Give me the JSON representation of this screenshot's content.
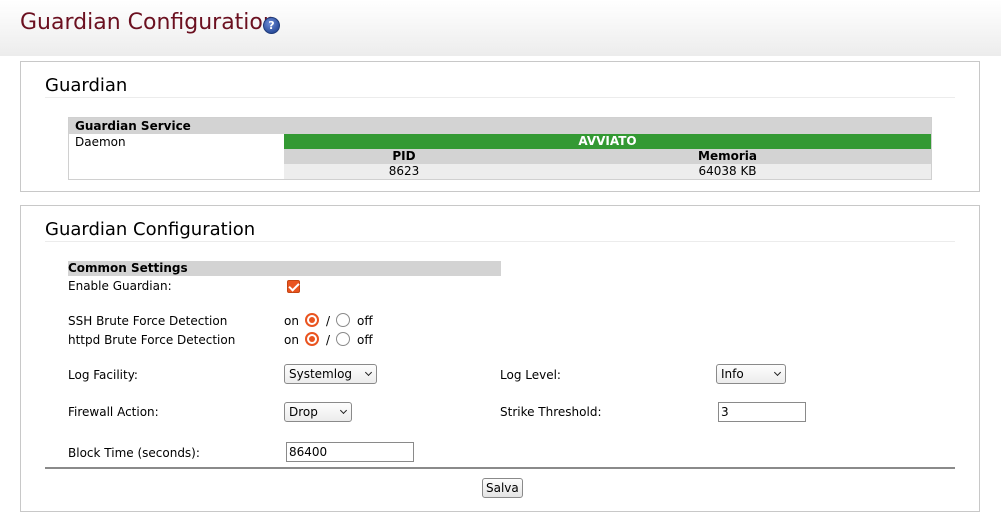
{
  "header": {
    "title": "Guardian Configuration",
    "help_icon": "help-icon"
  },
  "service_box": {
    "title": "Guardian",
    "table_header": "Guardian Service",
    "daemon_label": "Daemon",
    "status": "AVVIATO",
    "status_color": "#339933",
    "pid_header": "PID",
    "memory_header": "Memoria",
    "pid_value": "8623",
    "memory_value": "64038 KB"
  },
  "config_box": {
    "title": "Guardian Configuration",
    "section_header": "Common Settings",
    "enable_label": "Enable Guardian:",
    "enable_checked": true,
    "ssh_label": "SSH Brute Force Detection",
    "httpd_label": "httpd Brute Force Detection",
    "on_label": "on",
    "slash": "/",
    "off_label": "off",
    "ssh_value": "on",
    "httpd_value": "on",
    "log_facility_label": "Log Facility:",
    "log_facility_value": "Systemlog",
    "log_level_label": "Log Level:",
    "log_level_value": "Info",
    "firewall_action_label": "Firewall Action:",
    "firewall_action_value": "Drop",
    "strike_threshold_label": "Strike Threshold:",
    "strike_threshold_value": "3",
    "block_time_label": "Block Time (seconds):",
    "block_time_value": "86400",
    "save_label": "Salva",
    "accent_color": "#e95420"
  }
}
